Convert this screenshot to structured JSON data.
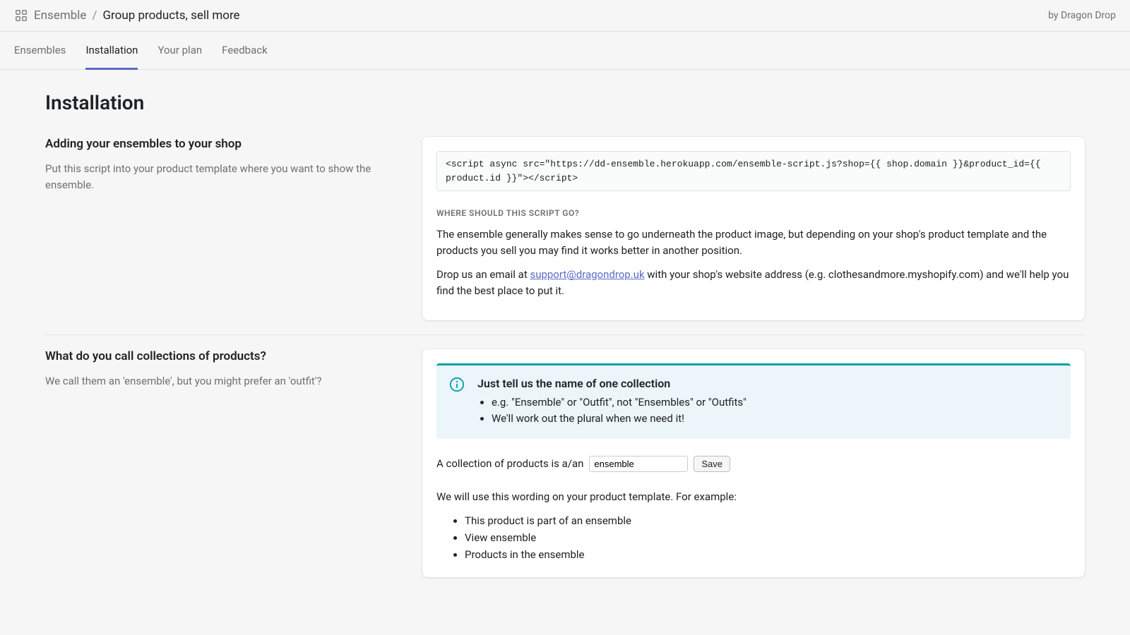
{
  "header": {
    "app_name": "Ensemble",
    "tagline": "Group products, sell more",
    "byline": "by Dragon Drop"
  },
  "tabs": [
    {
      "label": "Ensembles",
      "active": false
    },
    {
      "label": "Installation",
      "active": true
    },
    {
      "label": "Your plan",
      "active": false
    },
    {
      "label": "Feedback",
      "active": false
    }
  ],
  "page_title": "Installation",
  "section1": {
    "heading": "Adding your ensembles to your shop",
    "desc": "Put this script into your product template where you want to show the ensemble.",
    "code": "<script async src=\"https://dd-ensemble.herokuapp.com/ensemble-script.js?shop={{ shop.domain }}&product_id={{ product.id }}\"></script>",
    "sub_heading": "WHERE SHOULD THIS SCRIPT GO?",
    "p1": "The ensemble generally makes sense to go underneath the product image, but depending on your shop's product template and the products you sell you may find it works better in another position.",
    "p2_before": "Drop us an email at ",
    "p2_link": "support@dragondrop.uk",
    "p2_after": " with your shop's website address (e.g. clothesandmore.myshopify.com) and we'll help you find the best place to put it."
  },
  "section2": {
    "heading": "What do you call collections of products?",
    "desc": "We call them an 'ensemble', but you might prefer an 'outfit'?",
    "banner_title": "Just tell us the name of one collection",
    "banner_items": [
      "e.g. \"Ensemble\" or \"Outfit\", not \"Ensembles\" or \"Outfits\"",
      "We'll work out the plural when we need it!"
    ],
    "input_label": "A collection of products is a/an",
    "input_value": "ensemble",
    "save_label": "Save",
    "example_intro": "We will use this wording on your product template. For example:",
    "examples": [
      "This product is part of an ensemble",
      "View ensemble",
      "Products in the ensemble"
    ]
  }
}
